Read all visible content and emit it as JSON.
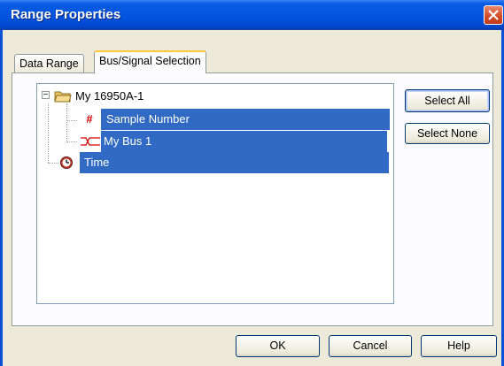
{
  "window": {
    "title": "Range Properties"
  },
  "tabs": [
    {
      "label": "Data Range"
    },
    {
      "label": "Bus/Signal Selection"
    }
  ],
  "tree": {
    "root": {
      "label": "My 16950A-1",
      "expander": "−",
      "icon": "folder-icon"
    },
    "children": [
      {
        "label": "Sample Number",
        "icon": "hash-icon",
        "icon_glyph": "#",
        "selected": true
      },
      {
        "label": "My Bus 1",
        "icon": "bus-icon",
        "selected": true
      }
    ],
    "time": {
      "label": "Time",
      "icon": "clock-icon",
      "selected": true
    }
  },
  "side_buttons": {
    "select_all": "Select All",
    "select_none": "Select None"
  },
  "footer": {
    "ok": "OK",
    "cancel": "Cancel",
    "help": "Help"
  },
  "colors": {
    "selection": "#316ac5",
    "title_bar": "#0454e0",
    "tab_highlight": "#ffc83c"
  }
}
